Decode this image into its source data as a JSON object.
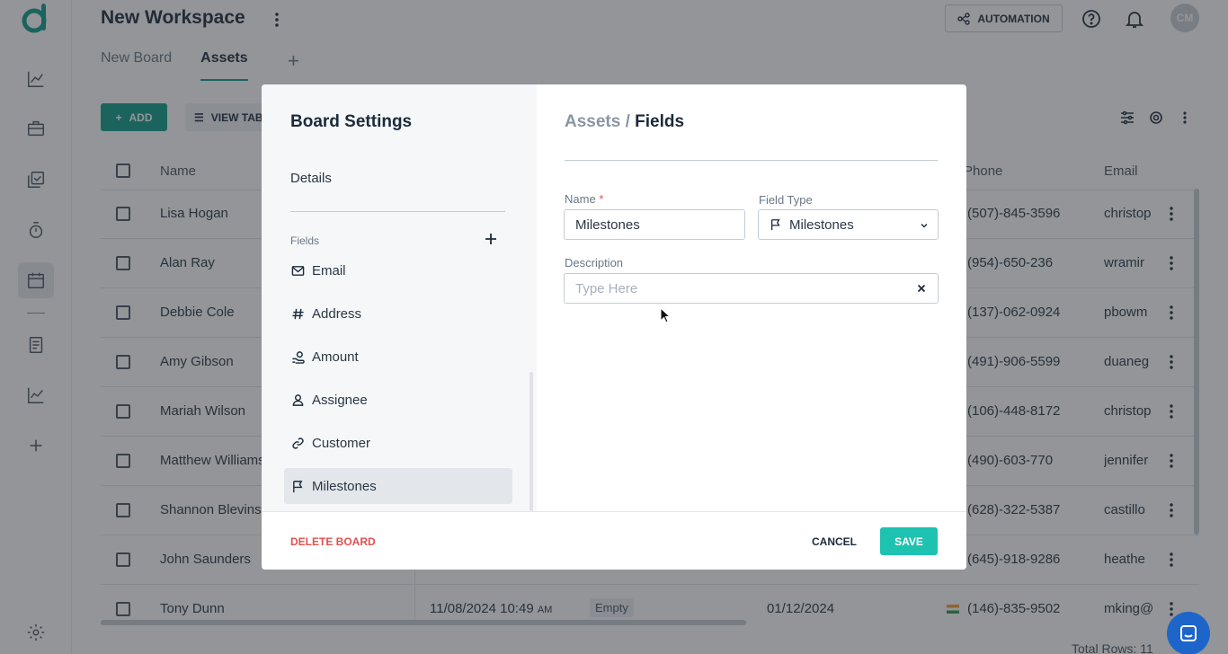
{
  "workspace": {
    "title": "New Workspace",
    "automation_label": "AUTOMATION",
    "avatar_initials": "CM"
  },
  "tabs": [
    {
      "label": "New Board"
    },
    {
      "label": "Assets"
    }
  ],
  "toolbar": {
    "add_label": "ADD",
    "view_label": "VIEW TAB"
  },
  "table": {
    "headers": {
      "name": "Name",
      "phone": "Phone",
      "email": "Email"
    },
    "rows": [
      {
        "name": "Lisa Hogan",
        "phone": "(507)-845-3596",
        "email": "christop"
      },
      {
        "name": "Alan Ray",
        "phone": "(954)-650-236",
        "email": "wramir"
      },
      {
        "name": "Debbie Cole",
        "phone": "(137)-062-0924",
        "email": "pbowm"
      },
      {
        "name": "Amy Gibson",
        "phone": "(491)-906-5599",
        "email": "duaneg"
      },
      {
        "name": "Mariah Wilson",
        "phone": "(106)-448-8172",
        "email": "christop"
      },
      {
        "name": "Matthew Williams",
        "phone": "(490)-603-770",
        "email": "jennifer"
      },
      {
        "name": "Shannon Blevins",
        "phone": "(628)-322-5387",
        "email": "castillo"
      },
      {
        "name": "John Saunders",
        "phone": "(645)-918-9286",
        "email": "heathe"
      },
      {
        "name": "Tony Dunn",
        "datetime": "11/08/2024 10:49",
        "ampm": "AM",
        "status": "Empty",
        "date": "01/12/2024",
        "phone": "(146)-835-9502",
        "email": "mking@"
      }
    ],
    "total_rows": "Total Rows: 11"
  },
  "modal": {
    "title": "Board Settings",
    "details_label": "Details",
    "fields_label": "Fields",
    "fields": [
      {
        "label": "Email",
        "icon": "mail-icon"
      },
      {
        "label": "Address",
        "icon": "hash-icon"
      },
      {
        "label": "Amount",
        "icon": "coins-icon"
      },
      {
        "label": "Assignee",
        "icon": "user-icon"
      },
      {
        "label": "Customer",
        "icon": "link-icon"
      },
      {
        "label": "Milestones",
        "icon": "flag-icon",
        "active": true
      }
    ],
    "breadcrumb": {
      "parent": "Assets",
      "separator": "/",
      "current": "Fields"
    },
    "form": {
      "name_label": "Name",
      "required_mark": "*",
      "name_value": "Milestones",
      "type_label": "Field Type",
      "type_value": "Milestones",
      "description_label": "Description",
      "description_placeholder": "Type Here"
    },
    "footer": {
      "delete_label": "DELETE BOARD",
      "cancel_label": "CANCEL",
      "save_label": "SAVE"
    }
  },
  "colors": {
    "accent": "#0f9d8a",
    "save": "#1ec2b0",
    "danger": "#e0524f",
    "chat": "#1e65c9"
  }
}
